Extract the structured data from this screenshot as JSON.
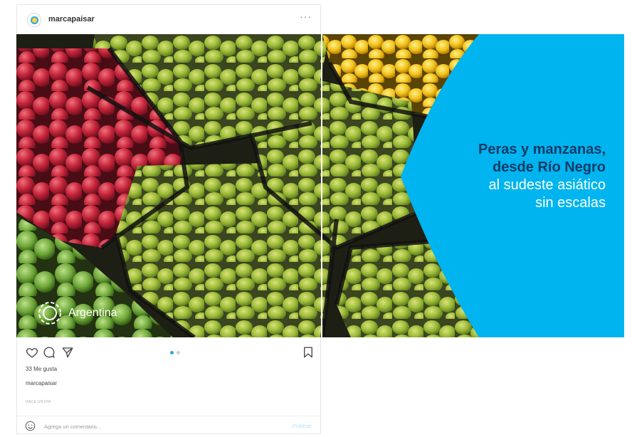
{
  "post": {
    "username": "marcapaisar",
    "more_label": "···",
    "likes": "33 Me gusta",
    "caption_user": "marcapaisar",
    "time": "HACE UN DÍA",
    "comment_placeholder": "Agrega un comentario...",
    "publish_label": "Publicar"
  },
  "slide": {
    "headline_dark_1": "Peras y manzanas,",
    "headline_dark_2": "desde Río Negro",
    "headline_light_1": "al sudeste asiático",
    "headline_light_2": "sin escalas",
    "brand_text": "Argentina"
  },
  "carousel": {
    "current": 1,
    "total": 2
  },
  "colors": {
    "accent_blue": "#00b4f0",
    "headline_dark": "#0d3b66",
    "pear_green": "#9fbd3a",
    "apple_red": "#c5253a",
    "lemon_yellow": "#f2c21b"
  },
  "icons": [
    "heart-icon",
    "comment-icon",
    "share-icon",
    "bookmark-icon",
    "emoji-icon",
    "argentina-sun-logo-icon"
  ]
}
